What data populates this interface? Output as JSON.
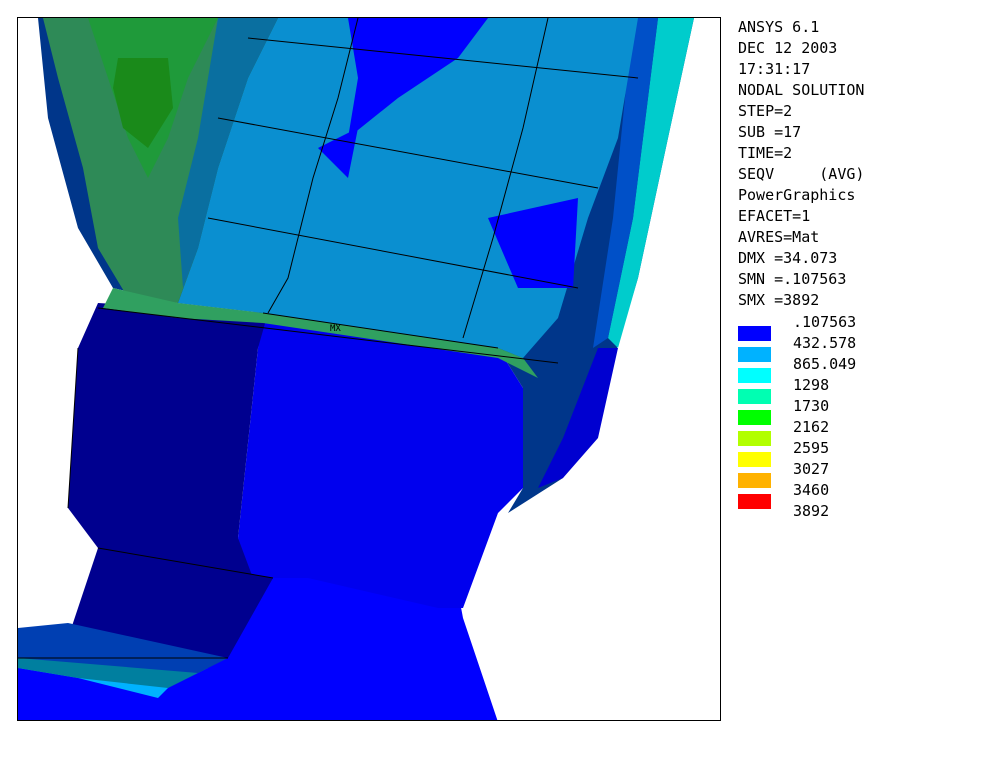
{
  "info": [
    "ANSYS 6.1",
    "DEC 12 2003",
    "17:31:17",
    "NODAL SOLUTION",
    "STEP=2",
    "SUB =17",
    "TIME=2",
    "SEQV     (AVG)",
    "PowerGraphics",
    "EFACET=1",
    "AVRES=Mat",
    "DMX =34.073",
    "SMN =.107563",
    "SMX =3892"
  ],
  "legend": [
    {
      "value": ".107563",
      "color": "#0000ff"
    },
    {
      "value": "432.578",
      "color": "#00b2ff"
    },
    {
      "value": "865.049",
      "color": "#00ffff"
    },
    {
      "value": "1298",
      "color": "#00ffb2"
    },
    {
      "value": "1730",
      "color": "#00ff00"
    },
    {
      "value": "2162",
      "color": "#b2ff00"
    },
    {
      "value": "2595",
      "color": "#ffff00"
    },
    {
      "value": "3027",
      "color": "#ffb200"
    },
    {
      "value": "3460",
      "color": "#ff0000"
    },
    {
      "value": "3892",
      "color": "#ff0000"
    }
  ],
  "mx_marker": "MX"
}
